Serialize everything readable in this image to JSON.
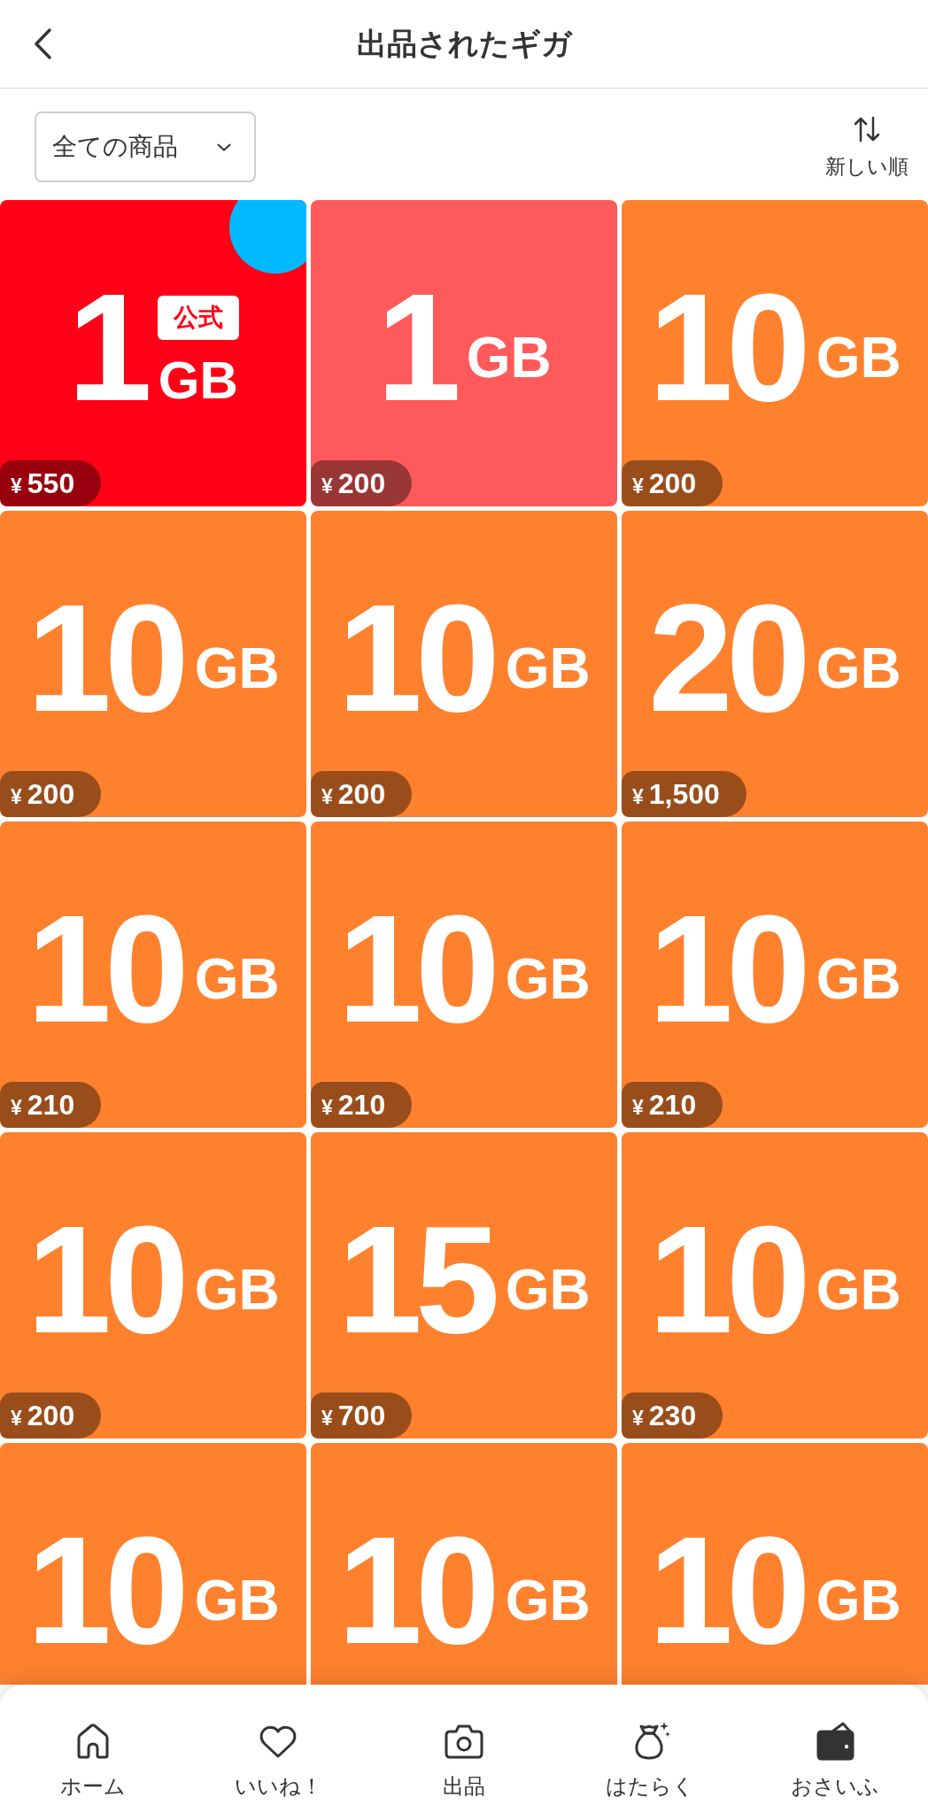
{
  "header": {
    "title": "出品されたギガ"
  },
  "filter": {
    "category": "全ての商品",
    "sort": "新しい順"
  },
  "listings": [
    {
      "amount": "1",
      "badge": "公式",
      "unit": "GB",
      "price": "¥550",
      "color": "#ff0016",
      "corner_marker": true
    },
    {
      "amount": "1",
      "unit": "GB",
      "price": "¥200",
      "color": "#ff5a5b",
      "corner_marker": false
    },
    {
      "amount": "10",
      "unit": "GB",
      "price": "¥200",
      "color": "#ff812e",
      "corner_marker": false
    },
    {
      "amount": "10",
      "unit": "GB",
      "price": "¥200",
      "color": "#ff812e",
      "corner_marker": false
    },
    {
      "amount": "10",
      "unit": "GB",
      "price": "¥200",
      "color": "#ff812e",
      "corner_marker": false
    },
    {
      "amount": "20",
      "unit": "GB",
      "price": "¥1,500",
      "color": "#ff812e",
      "corner_marker": false
    },
    {
      "amount": "10",
      "unit": "GB",
      "price": "¥210",
      "color": "#ff812e",
      "corner_marker": false
    },
    {
      "amount": "10",
      "unit": "GB",
      "price": "¥210",
      "color": "#ff812e",
      "corner_marker": false
    },
    {
      "amount": "10",
      "unit": "GB",
      "price": "¥210",
      "color": "#ff812e",
      "corner_marker": false
    },
    {
      "amount": "10",
      "unit": "GB",
      "price": "¥200",
      "color": "#ff812e",
      "corner_marker": false
    },
    {
      "amount": "15",
      "unit": "GB",
      "price": "¥700",
      "color": "#ff812e",
      "corner_marker": false
    },
    {
      "amount": "10",
      "unit": "GB",
      "price": "¥230",
      "color": "#ff812e",
      "corner_marker": false
    },
    {
      "amount": "10",
      "unit": "GB",
      "color": "#ff812e",
      "corner_marker": false
    },
    {
      "amount": "10",
      "unit": "GB",
      "color": "#ff812e",
      "corner_marker": false
    },
    {
      "amount": "10",
      "unit": "GB",
      "color": "#ff812e",
      "corner_marker": false
    }
  ],
  "nav": [
    {
      "label": "ホーム"
    },
    {
      "label": "いいね！"
    },
    {
      "label": "出品"
    },
    {
      "label": "はたらく"
    },
    {
      "label": "おさいふ"
    }
  ]
}
